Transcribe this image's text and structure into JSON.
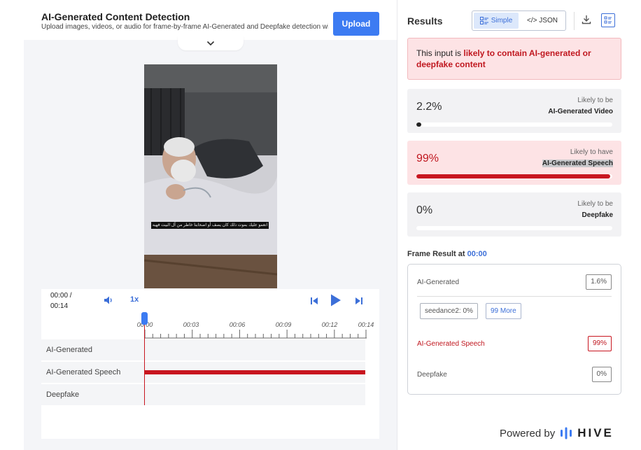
{
  "header": {
    "title": "AI-Generated Content Detection",
    "subtitle": "Upload images, videos, or audio for frame-by-frame AI-Generated and Deepfake detection with...",
    "upload_label": "Upload"
  },
  "video": {
    "subtitle_text": "انعمو عليك بموت ذلك كان يصف أو اصحابنا خاطر من آل البيت فهيه"
  },
  "player": {
    "current_time": "00:00 /",
    "duration": "00:14",
    "speed": "1x",
    "ticks": [
      "00:00",
      "00:03",
      "00:06",
      "00:09",
      "00:12",
      "00:14"
    ],
    "tracks": [
      {
        "label": "AI-Generated",
        "has_bar": false
      },
      {
        "label": "AI-Generated Speech",
        "has_bar": true
      },
      {
        "label": "Deepfake",
        "has_bar": false
      }
    ]
  },
  "results": {
    "title": "Results",
    "view_simple": "Simple",
    "view_json": "</> JSON",
    "alert_prefix": "This input is ",
    "alert_highlight": "likely to contain AI-generated or deepfake content",
    "cards": [
      {
        "pct": "2.2%",
        "sub": "Likely to be",
        "name": "AI-Generated Video",
        "value": 0.022,
        "style": "gray"
      },
      {
        "pct": "99%",
        "sub": "Likely to have",
        "name": "AI-Generated Speech",
        "value": 0.99,
        "style": "red"
      },
      {
        "pct": "0%",
        "sub": "Likely to be",
        "name": "Deepfake",
        "value": 0.0,
        "style": "gray"
      }
    ],
    "frame_label": "Frame Result at ",
    "frame_time": "00:00",
    "frame": {
      "ai_label": "AI-Generated",
      "ai_value": "1.6%",
      "chip_model": "seedance2: 0%",
      "chip_more": "99 More",
      "speech_label": "AI-Generated Speech",
      "speech_value": "99%",
      "deepfake_label": "Deepfake",
      "deepfake_value": "0%"
    },
    "powered_by": "Powered by",
    "brand": "HIVE"
  },
  "colors": {
    "accent": "#3c7bf2",
    "alert_red": "#c0171f",
    "bar_red": "#c8151f"
  }
}
